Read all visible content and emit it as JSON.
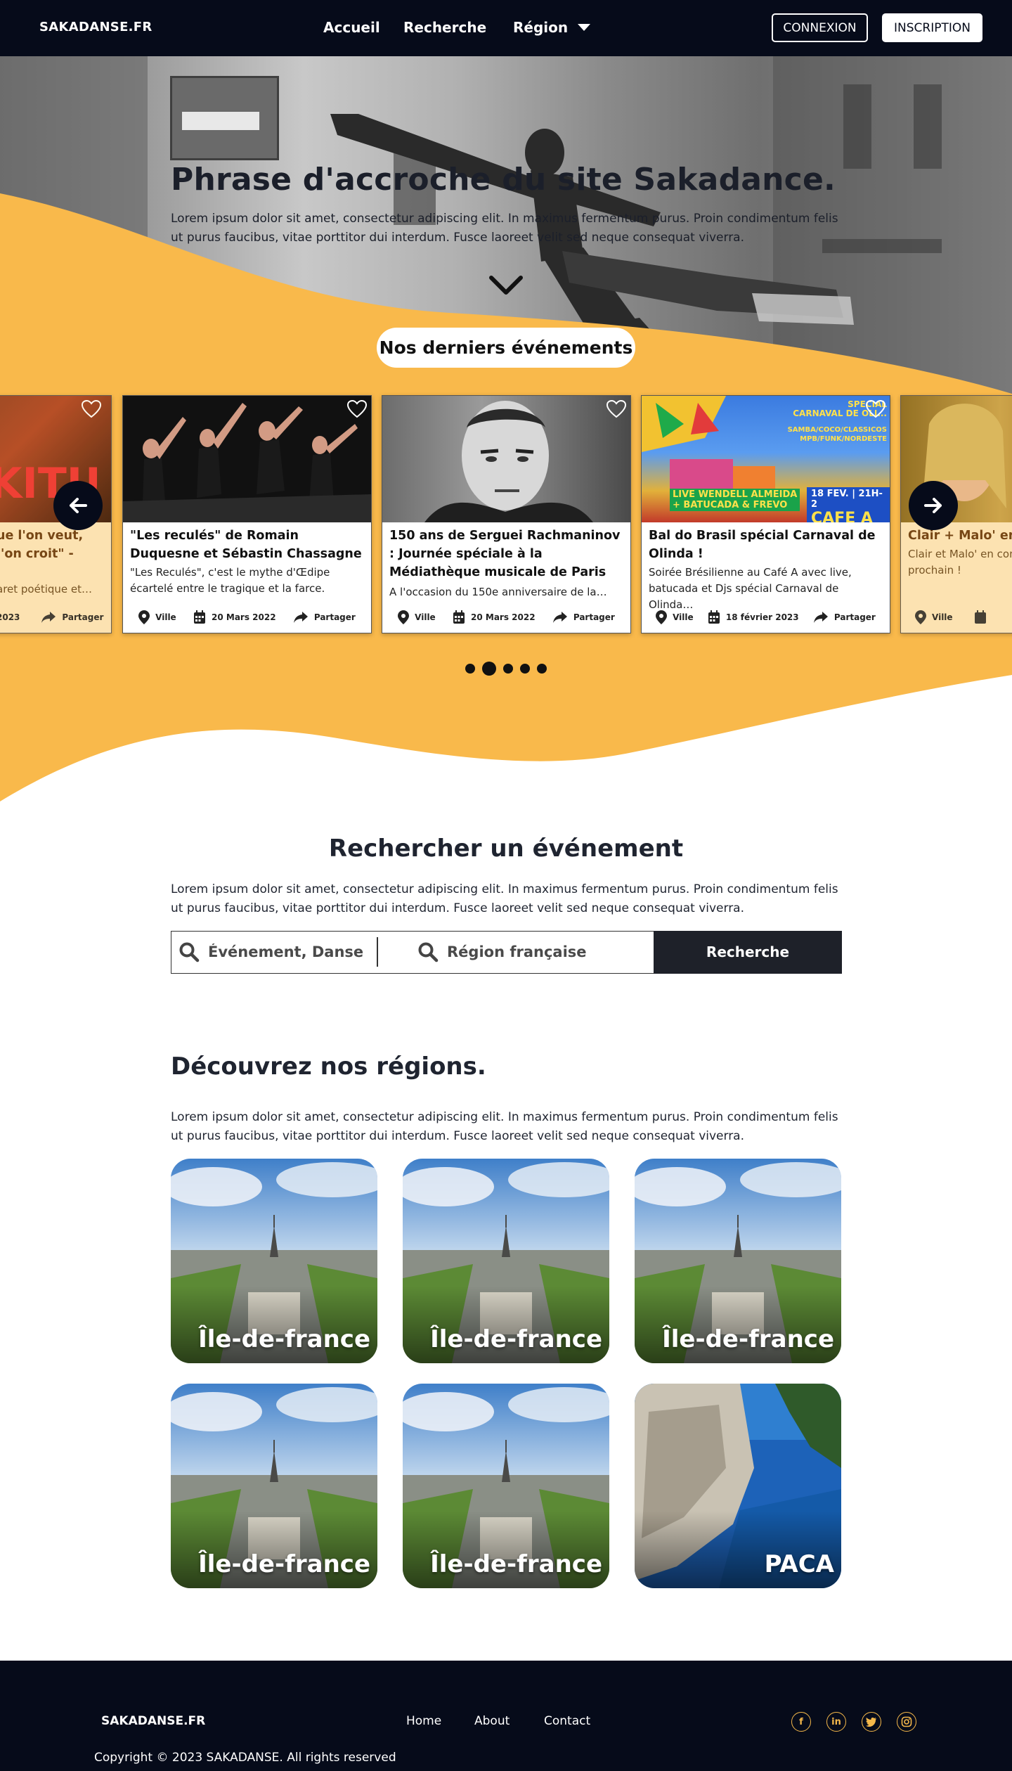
{
  "nav": {
    "brand": "SAKADANSE.FR",
    "links": [
      "Accueil",
      "Recherche",
      "Région"
    ],
    "login": "CONNEXION",
    "signup": "INSCRIPTION"
  },
  "hero": {
    "title": "Phrase d'accroche du site Sakadance.",
    "text": "Lorem ipsum dolor sit amet, consectetur adipiscing elit. In maximus fermentum purus. Proin condimentum felis ut purus faucibus, vitae porttitor dui interdum. Fusce laoreet velit sed neque consequat viverra.",
    "events_heading": "Nos derniers événements"
  },
  "events": [
    {
      "title": "ue l'on veut, l'on croit\" -",
      "desc": "aret poétique et…",
      "city": "",
      "date": "2023",
      "share": "Partager"
    },
    {
      "title": "\"Les reculés\" de Romain Duquesne et Sébastin Chassagne",
      "desc": "\"Les Reculés\", c'est le mythe d'Œdipe écartelé entre le tragique et la farce.",
      "city": "Ville",
      "date": "20 Mars 2022",
      "share": "Partager"
    },
    {
      "title": "150 ans de Serguei Rachmaninov : Journée spéciale à la Médiathèque musicale de Paris",
      "desc": "A l'occasion du 150e anniversaire de la…",
      "city": "Ville",
      "date": "20 Mars 2022",
      "share": "Partager"
    },
    {
      "title": "Bal do Brasil spécial Carnaval de Olinda !",
      "desc": "Soirée Brésilienne au Café A avec live, batucada et Djs spécial Carnaval de Olinda…",
      "city": "Ville",
      "date": "18 février 2023",
      "share": "Partager",
      "poster_lines": [
        "SPECIAL",
        "CARNAVAL DE OLI...",
        "SAMBA/COCO/CLASSICOS",
        "MPB/FUNK/NORDESTE",
        "LIVE WENDELL ALMEIDA",
        "+ BATUCADA & FREVO",
        "18 FEV. | 21H-2",
        "CAFE A"
      ]
    },
    {
      "title": "Clair + Malo' en c",
      "desc": "Clair et Malo' en con prochain !",
      "city": "Ville",
      "date": "",
      "share": ""
    }
  ],
  "carousel": {
    "dot_count": 5,
    "active_dot": 1
  },
  "search": {
    "title": "Rechercher un événement",
    "text": "Lorem ipsum dolor sit amet, consectetur adipiscing elit. In maximus fermentum purus. Proin condimentum felis ut purus faucibus, vitae porttitor dui interdum. Fusce laoreet velit sed neque consequat viverra.",
    "event_placeholder": "Événement, Danse",
    "region_placeholder": "Région française",
    "button": "Recherche"
  },
  "regions": {
    "title": "Découvrez nos régions.",
    "text": "Lorem ipsum dolor sit amet, consectetur adipiscing elit. In maximus fermentum purus. Proin condimentum felis ut purus faucibus, vitae porttitor dui interdum. Fusce laoreet velit sed neque consequat viverra.",
    "tiles": [
      "Île-de-france",
      "Île-de-france",
      "Île-de-france",
      "Île-de-france",
      "Île-de-france",
      "PACA"
    ]
  },
  "footer": {
    "brand": "SAKADANSE.FR",
    "links": [
      "Home",
      "About",
      "Contact"
    ],
    "socials": [
      "facebook-icon",
      "linkedin-icon",
      "twitter-icon",
      "instagram-icon"
    ],
    "copyright": "Copyright © 2023 SAKADANSE. All rights reserved"
  },
  "colors": {
    "navy": "#060b1a",
    "accent": "#f9b94b",
    "button_dark": "#1e2129"
  }
}
